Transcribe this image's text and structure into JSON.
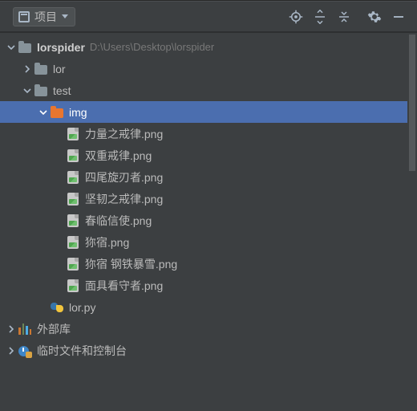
{
  "toolbar": {
    "project_label": "项目"
  },
  "root": {
    "name": "lorspider",
    "path": "D:\\Users\\Desktop\\lorspider"
  },
  "lor_folder": "lor",
  "test_folder": "test",
  "img_folder": "img",
  "files": [
    "力量之戒律.png",
    "双重戒律.png",
    "四尾旋刃者.png",
    "坚韧之戒律.png",
    "春临信使.png",
    "狝宿.png",
    "狝宿 钢铁暴雪.png",
    "面具看守者.png"
  ],
  "py_file": "lor.py",
  "ext_libs": "外部库",
  "scratches": "临时文件和控制台"
}
